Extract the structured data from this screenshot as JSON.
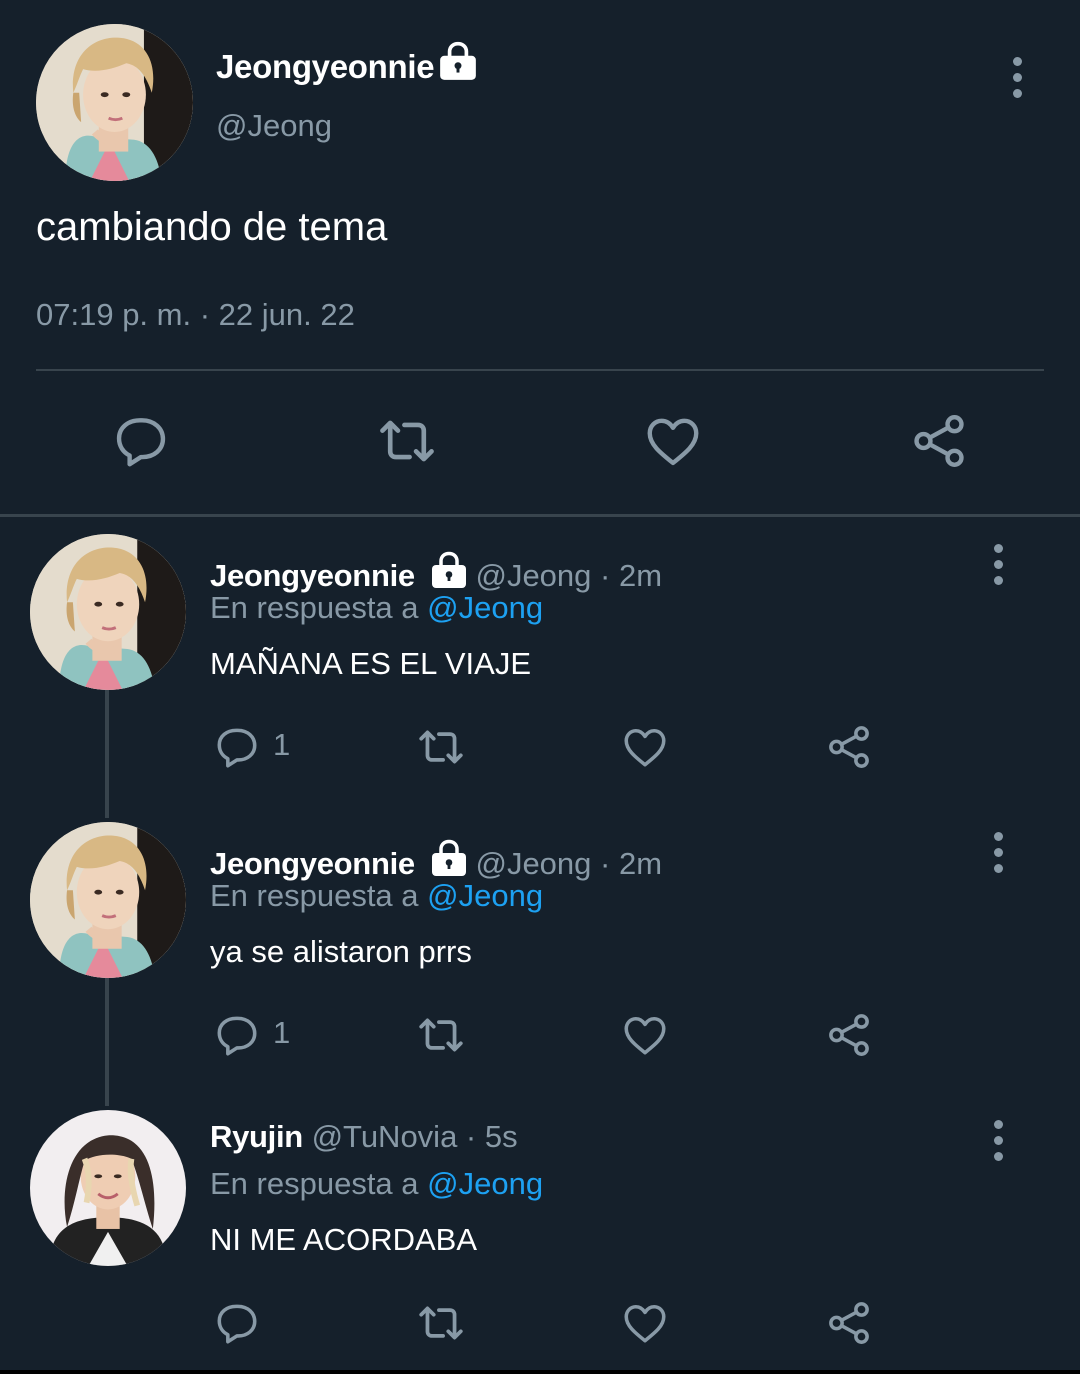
{
  "main_tweet": {
    "display_name": "Jeongyeonnie",
    "handle": "@Jeong",
    "text": "cambiando de tema",
    "timestamp": "07:19 p. m. · 22 jun. 22",
    "icons": [
      "lock-icon",
      "more-vertical-icon",
      "reply-icon",
      "retweet-icon",
      "like-icon",
      "share-icon"
    ]
  },
  "replies": [
    {
      "display_name": "Jeongyeonnie",
      "meta": "@Jeong · 2m",
      "reply_prefix": "En respuesta a",
      "mention": "@Jeong",
      "text": "MAÑANA ES EL VIAJE",
      "reply_count": "1"
    },
    {
      "display_name": "Jeongyeonnie",
      "meta": "@Jeong · 2m",
      "reply_prefix": "En respuesta a",
      "mention": "@Jeong",
      "text": "ya se alistaron prrs",
      "reply_count": "1"
    },
    {
      "display_name": "Ryujin",
      "meta": "@TuNovia · 5s",
      "reply_prefix": "En respuesta a",
      "mention": "@Jeong",
      "text": "NI ME ACORDABA",
      "reply_count": ""
    }
  ],
  "colors": {
    "background": "#15202b",
    "secondary_text": "#8899a6",
    "link": "#1da1f2",
    "divider": "#38444d"
  }
}
